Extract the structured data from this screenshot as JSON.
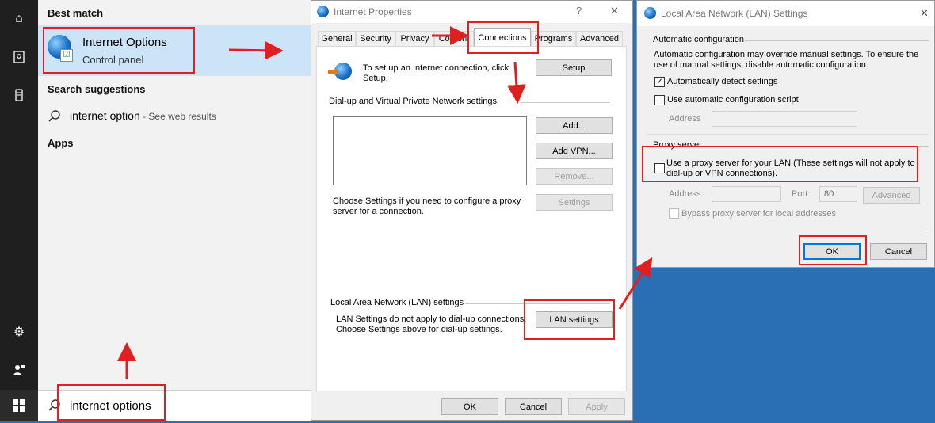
{
  "start_menu": {
    "best_match_heading": "Best match",
    "best_match": {
      "title": "Internet Options",
      "subtitle": "Control panel"
    },
    "search_suggestions_heading": "Search suggestions",
    "suggestion": {
      "text": "internet option",
      "suffix": " - See web results"
    },
    "apps_heading": "Apps",
    "search_query": "internet options"
  },
  "internet_properties": {
    "title": "Internet Properties",
    "help": "?",
    "close": "✕",
    "tabs": [
      {
        "label": "General"
      },
      {
        "label": "Security"
      },
      {
        "label": "Privacy"
      },
      {
        "label": "Content"
      },
      {
        "label": "Connections"
      },
      {
        "label": "Programs"
      },
      {
        "label": "Advanced"
      }
    ],
    "setup_text": "To set up an Internet connection, click Setup.",
    "setup_btn": "Setup",
    "dialup_heading": "Dial-up and Virtual Private Network settings",
    "add_btn": "Add...",
    "add_vpn_btn": "Add VPN...",
    "remove_btn": "Remove...",
    "settings_btn": "Settings",
    "proxy_note": "Choose Settings if you need to configure a proxy server for a connection.",
    "lan_heading": "Local Area Network (LAN) settings",
    "lan_note_1": "LAN Settings do not apply to dial-up connections.",
    "lan_note_2": "Choose Settings above for dial-up settings.",
    "lan_settings_btn": "LAN settings",
    "ok_btn": "OK",
    "cancel_btn": "Cancel",
    "apply_btn": "Apply"
  },
  "lan_settings": {
    "title": "Local Area Network (LAN) Settings",
    "close": "✕",
    "auto_config_heading": "Automatic configuration",
    "auto_config_note": "Automatic configuration may override manual settings.  To ensure the use of manual settings, disable automatic configuration.",
    "auto_detect_label": "Automatically detect settings",
    "auto_detect_checked": true,
    "auto_script_label": "Use automatic configuration script",
    "auto_script_checked": false,
    "address_label": "Address",
    "proxy_heading": "Proxy server",
    "use_proxy_label_1": "Use a proxy server for your LAN (These settings will not apply to",
    "use_proxy_label_2": "dial-up or VPN connections).",
    "use_proxy_checked": false,
    "proxy_address_label": "Address:",
    "port_label": "Port:",
    "port_value": "80",
    "advanced_btn": "Advanced",
    "bypass_label": "Bypass proxy server for local addresses",
    "ok_btn": "OK",
    "cancel_btn": "Cancel"
  },
  "colors": {
    "annotation": "#e02020",
    "selection": "#cce4f7",
    "desktop": "#2a6fb3"
  }
}
